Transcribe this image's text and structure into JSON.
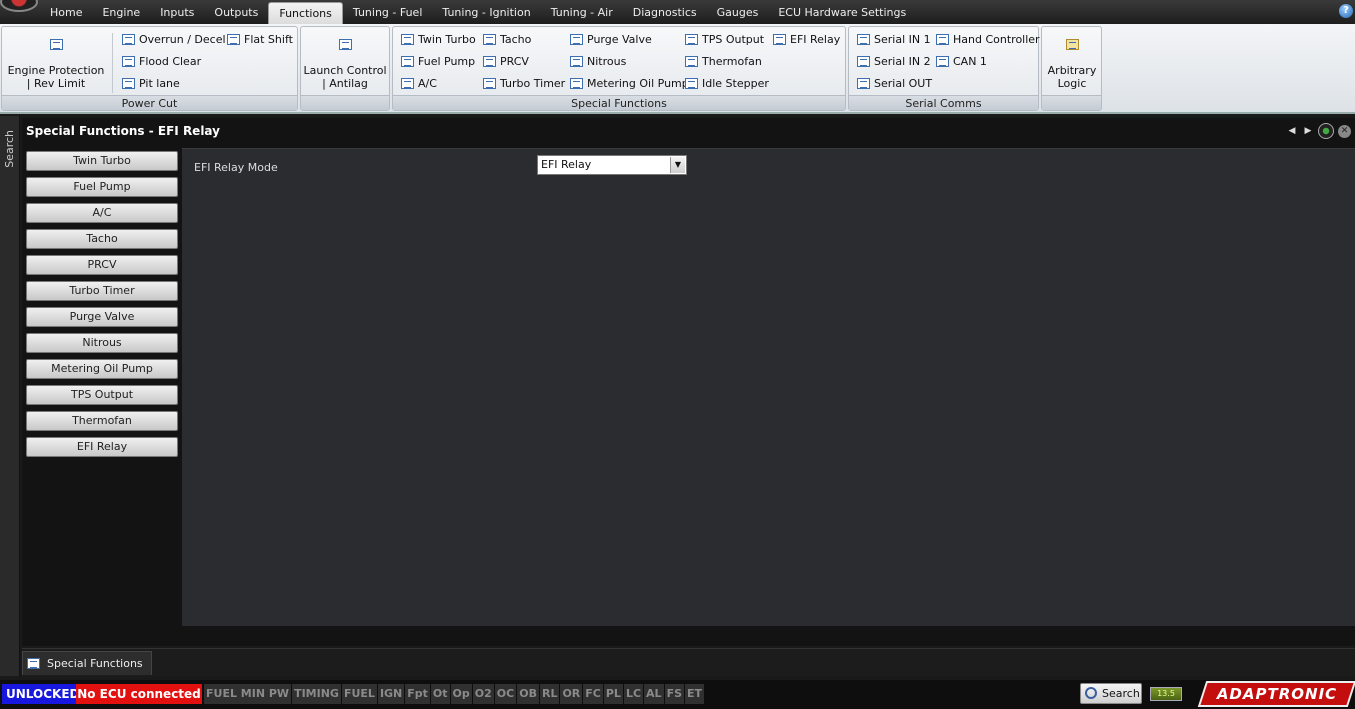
{
  "menu": {
    "tabs": [
      "Home",
      "Engine",
      "Inputs",
      "Outputs",
      "Functions",
      "Tuning - Fuel",
      "Tuning - Ignition",
      "Tuning - Air",
      "Diagnostics",
      "Gauges",
      "ECU Hardware Settings"
    ],
    "active": "Functions",
    "help_label": "?"
  },
  "ribbon": {
    "power_cut": {
      "label": "Power Cut",
      "engine_protection": "Engine Protection | Rev Limit",
      "overrun_decel": "Overrun / Decel",
      "flat_shift": "Flat Shift",
      "flood_clear": "Flood Clear",
      "pit_lane": "Pit lane"
    },
    "launch": {
      "launch_control": "Launch Control | Antilag"
    },
    "special_functions": {
      "label": "Special Functions",
      "twin_turbo": "Twin Turbo",
      "fuel_pump": "Fuel Pump",
      "ac": "A/C",
      "tacho": "Tacho",
      "prcv": "PRCV",
      "turbo_timer": "Turbo Timer",
      "purge_valve": "Purge Valve",
      "nitrous": "Nitrous",
      "metering_oil_pump": "Metering Oil Pump",
      "tps_output": "TPS Output",
      "thermofan": "Thermofan",
      "idle_stepper": "Idle Stepper",
      "efi_relay": "EFI Relay"
    },
    "serial_comms": {
      "label": "Serial Comms",
      "serial_in_1": "Serial IN 1",
      "serial_in_2": "Serial IN 2",
      "serial_out": "Serial OUT",
      "hand_controller": "Hand Controller",
      "can_1": "CAN 1"
    },
    "arbitrary_logic": "Arbitrary Logic"
  },
  "sidebar": {
    "search_label": "Search"
  },
  "panel": {
    "title": "Special Functions - EFI Relay",
    "functions": [
      "Twin Turbo",
      "Fuel Pump",
      "A/C",
      "Tacho",
      "PRCV",
      "Turbo Timer",
      "Purge Valve",
      "Nitrous",
      "Metering Oil Pump",
      "TPS Output",
      "Thermofan",
      "EFI Relay"
    ],
    "relay_mode_label": "EFI Relay Mode",
    "relay_mode_value": "EFI Relay"
  },
  "doc_tab": {
    "label": "Special Functions"
  },
  "status": {
    "lock": "UNLOCKED",
    "ecu": "No ECU connected",
    "indicators": [
      "FUEL MIN PW",
      "TIMING",
      "FUEL",
      "IGN",
      "Fpt",
      "Ot",
      "Op",
      "O2",
      "OC",
      "OB",
      "RL",
      "OR",
      "FC",
      "PL",
      "LC",
      "AL",
      "FS",
      "ET"
    ],
    "search_label": "Search",
    "battery_label": "13.5",
    "brand": "ADAPTRONIC"
  }
}
